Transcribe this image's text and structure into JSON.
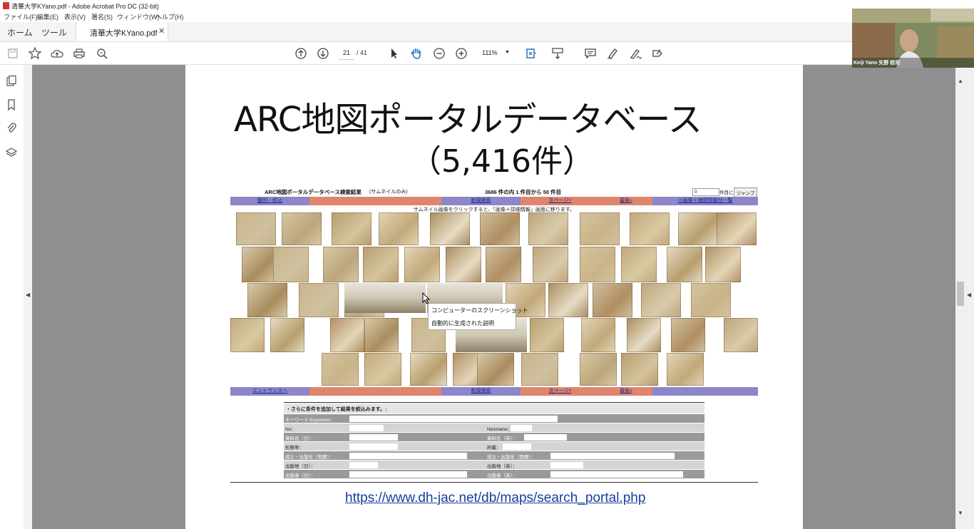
{
  "window": {
    "title": "清華大学KYano.pdf - Adobe Acrobat Pro DC (32-bit)"
  },
  "menu": [
    "ファイル(F)",
    "編集(E)",
    "表示(V)",
    "署名(S)",
    "ウィンドウ(W)",
    "ヘルプ(H)"
  ],
  "tabs": {
    "home": "ホーム",
    "tools": "ツール",
    "document": "清華大学KYano.pdf"
  },
  "toolbar": {
    "page_current": "21",
    "page_total": "/ 41",
    "zoom": "111%"
  },
  "slide": {
    "title": "ARC地図ポータルデータベース",
    "subtitle": "（5,416件）",
    "url": "https://www.dh-jac.net/db/maps/search_portal.php"
  },
  "embedded_page": {
    "heading": "ARC地図ポータルデータベース検索結果",
    "heading_note": "(サムネイルのみ)",
    "count_text": "3686 件の内 1 件目から 50 件目",
    "jump_input": "0",
    "jump_suffix": "件目に",
    "jump_button": "ジャンプ",
    "nav_top": [
      "整列・絞込",
      "",
      "",
      "新規検索",
      "次ページ>",
      "最後»",
      "小画像＋諸録情報付一覧"
    ],
    "hint": "サムネイル画像をクリックすると、「画像＋詳細情報」画面に移ります。",
    "nav_bottom": [
      "エントランスへ",
      "",
      "",
      "新規検索",
      "次ページ>",
      "最後»",
      ""
    ],
    "form_title": "・さらに条件を追加して結果を絞込みます。↓",
    "form_rows": [
      [
        "キーワード Keywords：",
        ""
      ],
      [
        "No：",
        "Nickname："
      ],
      [
        "資料名（日）：",
        "資料名（英）："
      ],
      [
        "形態等：",
        "所蔵："
      ],
      [
        "成立・出版年（和暦）：",
        "成立・出版年（西暦）："
      ],
      [
        "出版地（日）：",
        "出版地（英）："
      ],
      [
        "出版者（日）：",
        "出版者（英）："
      ]
    ]
  },
  "tooltip": {
    "line1": "コンピューターのスクリーンショット",
    "line2": "自動的に生成された説明"
  },
  "video": {
    "caption": "Keiji Yano 矢野 桂司"
  },
  "colors": {
    "nav_blue": "#8d86c9",
    "nav_salmon": "#e0856d",
    "doc_gray": "#8f8f8f"
  }
}
